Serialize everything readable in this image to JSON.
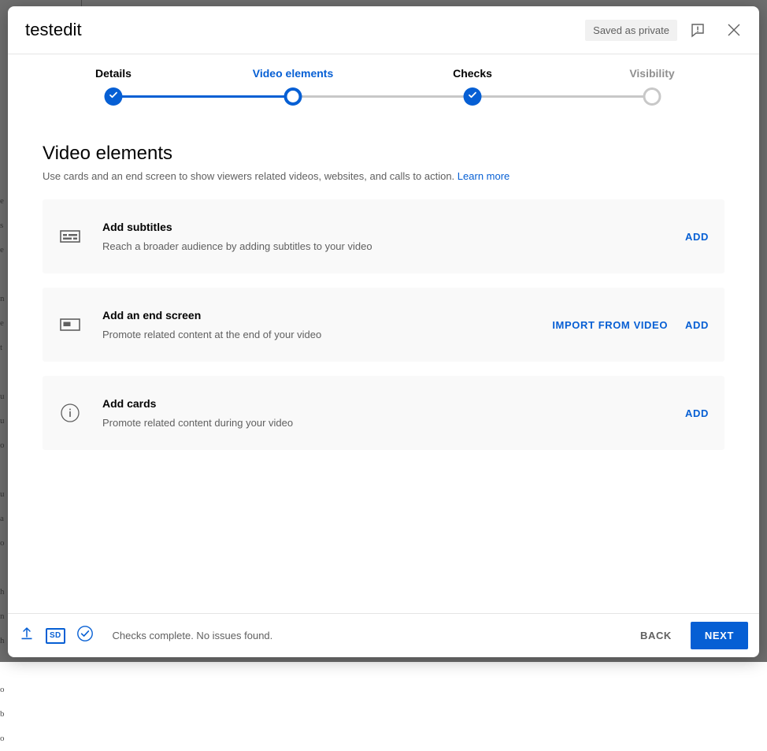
{
  "backdrop": {
    "edge_text": "e\ns\ne\n\nn\ne\nt\n\nu\nu\no\n\nu\na\no\n\nh\nn\nh\n\no\nb\no"
  },
  "header": {
    "title": "testedit",
    "saved_status": "Saved as private",
    "feedback_icon": "feedback-exclamation-icon",
    "close_icon": "close-icon"
  },
  "stepper": {
    "steps": [
      {
        "label": "Details",
        "state": "done"
      },
      {
        "label": "Video elements",
        "state": "current"
      },
      {
        "label": "Checks",
        "state": "done"
      },
      {
        "label": "Visibility",
        "state": "todo"
      }
    ]
  },
  "main": {
    "title": "Video elements",
    "subtitle": "Use cards and an end screen to show viewers related videos, websites, and calls to action.",
    "learn_more": "Learn more",
    "cards": [
      {
        "icon": "subtitles-icon",
        "title": "Add subtitles",
        "description": "Reach a broader audience by adding subtitles to your video",
        "actions": [
          "ADD"
        ]
      },
      {
        "icon": "end-screen-icon",
        "title": "Add an end screen",
        "description": "Promote related content at the end of your video",
        "actions": [
          "IMPORT FROM VIDEO",
          "ADD"
        ]
      },
      {
        "icon": "info-circle-icon",
        "title": "Add cards",
        "description": "Promote related content during your video",
        "actions": [
          "ADD"
        ]
      }
    ]
  },
  "footer": {
    "upload_icon": "upload-arrow-icon",
    "quality_badge": "SD",
    "checks_icon": "check-circle-icon",
    "status_text": "Checks complete. No issues found.",
    "back_label": "BACK",
    "next_label": "NEXT"
  },
  "colors": {
    "accent": "#065fd4",
    "card_bg": "#f9f9f9",
    "text_primary": "#030303",
    "text_secondary": "#606060",
    "track_inactive": "#c8c8c8"
  }
}
